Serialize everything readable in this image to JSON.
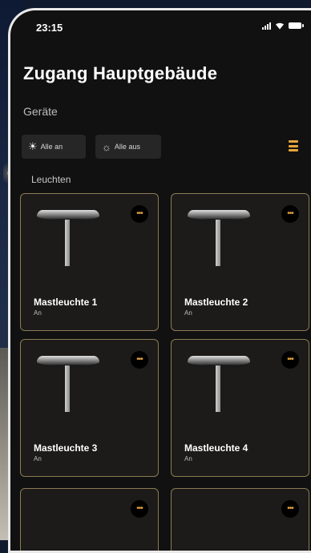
{
  "status_bar": {
    "time": "23:15"
  },
  "header": {
    "title": "Zugang Hauptgebäude",
    "section": "Geräte"
  },
  "actions": {
    "all_on": "Alle an",
    "all_off": "Alle aus"
  },
  "group": {
    "label": "Leuchten"
  },
  "devices": [
    {
      "name": "Mastleuchte 1",
      "status": "An"
    },
    {
      "name": "Mastleuchte 2",
      "status": "An"
    },
    {
      "name": "Mastleuchte  3",
      "status": "An"
    },
    {
      "name": "Mastleuchte 4",
      "status": "An"
    }
  ],
  "icons": {
    "more": "more-dots-icon",
    "sun": "sun-icon",
    "sun_outline": "sun-outline-icon",
    "view": "list-view-icon"
  },
  "colors": {
    "accent": "#e6a53a",
    "card_border": "#8c7a55",
    "background": "#111111"
  }
}
